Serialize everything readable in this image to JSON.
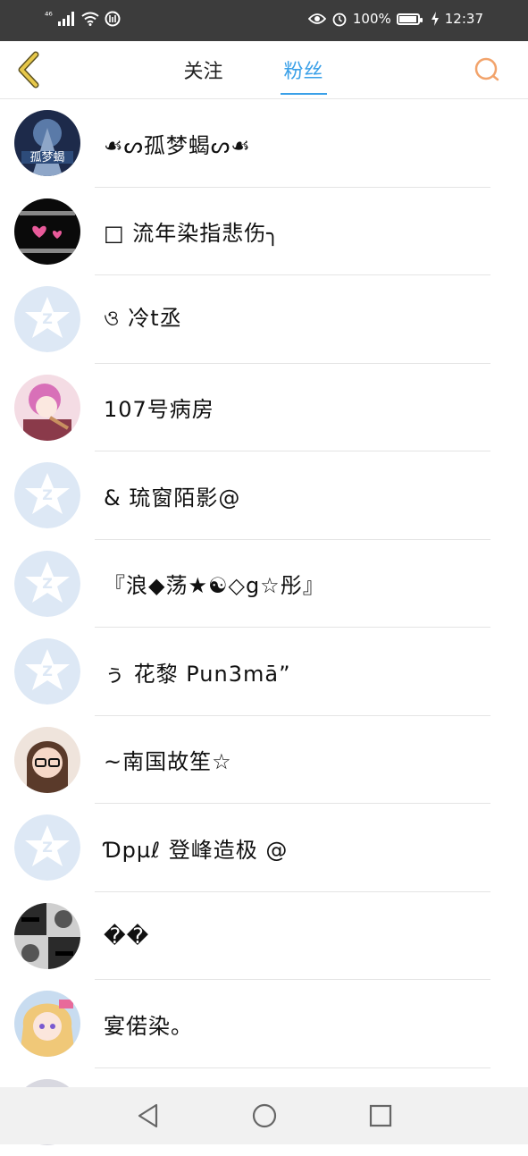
{
  "status_bar": {
    "network": "⁴⁶",
    "battery": "100%",
    "time": "12:37",
    "icons": [
      "signal-icon",
      "wifi-icon",
      "data-saver-icon",
      "eye-icon",
      "alarm-icon",
      "battery-icon",
      "charging-icon"
    ]
  },
  "header": {
    "tabs": [
      {
        "label": "关注",
        "active": false
      },
      {
        "label": "粉丝",
        "active": true
      }
    ],
    "accent_color": "#3aa0e8",
    "back_icon_color": "#e7c84a",
    "search_icon_color": "#f2a36b"
  },
  "fans": [
    {
      "name": "☙ᔕ孤梦蝎ᔕ☙",
      "avatar": "photo-dark-blue"
    },
    {
      "name": "□ 流年染指悲伤╮",
      "avatar": "photo-black-hearts"
    },
    {
      "name": "ও 冷t丞",
      "avatar": "default"
    },
    {
      "name": "107号病房",
      "avatar": "photo-anime-pink"
    },
    {
      "name": "& 琉窗陌影@",
      "avatar": "default"
    },
    {
      "name": "『浪◆荡★☯◇g☆彤』",
      "avatar": "default"
    },
    {
      "name": "ぅ 花黎 Pun3mā”",
      "avatar": "default"
    },
    {
      "name": "~南国故笙☆",
      "avatar": "photo-girl-glasses"
    },
    {
      "name": "Ɗpµℓ 登峰造极 @",
      "avatar": "default"
    },
    {
      "name": "��",
      "avatar": "photo-grid-bw"
    },
    {
      "name": "宴偌染。",
      "avatar": "photo-anime-blonde"
    }
  ],
  "nav": {
    "icons": [
      "back-triangle-icon",
      "home-circle-icon",
      "recents-square-icon"
    ]
  }
}
